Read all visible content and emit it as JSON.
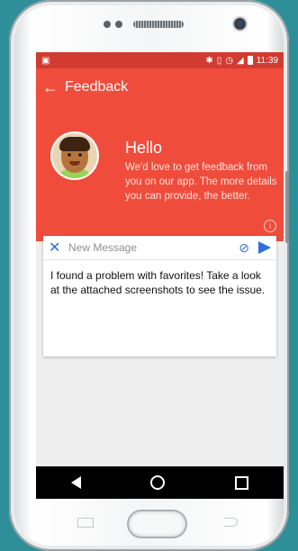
{
  "device": {
    "status_bar": {
      "time": "11:39",
      "icons": [
        "bluetooth",
        "vibrate",
        "alarm",
        "signal",
        "battery"
      ]
    },
    "nav_bar": {
      "buttons": [
        "back",
        "home",
        "recent"
      ]
    }
  },
  "app": {
    "toolbar": {
      "title": "Feedback",
      "back_icon": "←"
    },
    "hero": {
      "greeting": "Hello",
      "message": "We'd love to get feedback from you on our app. The more details you can provide, the better.",
      "info_icon": "i"
    },
    "compose": {
      "close_icon": "✕",
      "placeholder": "New Message",
      "attach_icon": "⊘",
      "body": "I found a problem with favorites! Take a look at the attached screenshots to see the issue."
    }
  },
  "colors": {
    "primary": "#ef4c3c",
    "statusbar": "#d13b30",
    "accent": "#2f6de0"
  }
}
